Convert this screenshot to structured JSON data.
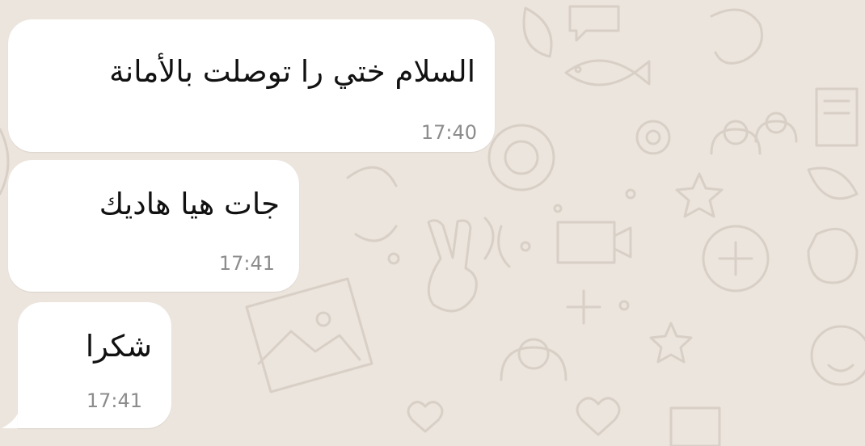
{
  "chat": {
    "messages": [
      {
        "text": "السلام ختي را توصلت بالأمانة",
        "time": "17:40",
        "direction": "incoming"
      },
      {
        "text": "جات هيا هاديك",
        "time": "17:41",
        "direction": "incoming"
      },
      {
        "text": "شكرا",
        "time": "17:41",
        "direction": "incoming"
      }
    ]
  },
  "theme": {
    "background": "#ECE5DD",
    "bubble": "#FFFFFF",
    "text": "#111111",
    "time": "#8C8C8C",
    "doodle": "#D8D0C6"
  },
  "icons": {
    "wallpaper": [
      "fish-icon",
      "gear-icon",
      "people-icon",
      "camera-icon",
      "star-icon",
      "turtle-icon",
      "victory-hand-icon",
      "picture-icon",
      "person-icon",
      "leaf-icon",
      "heart-icon",
      "smiley-icon"
    ]
  }
}
